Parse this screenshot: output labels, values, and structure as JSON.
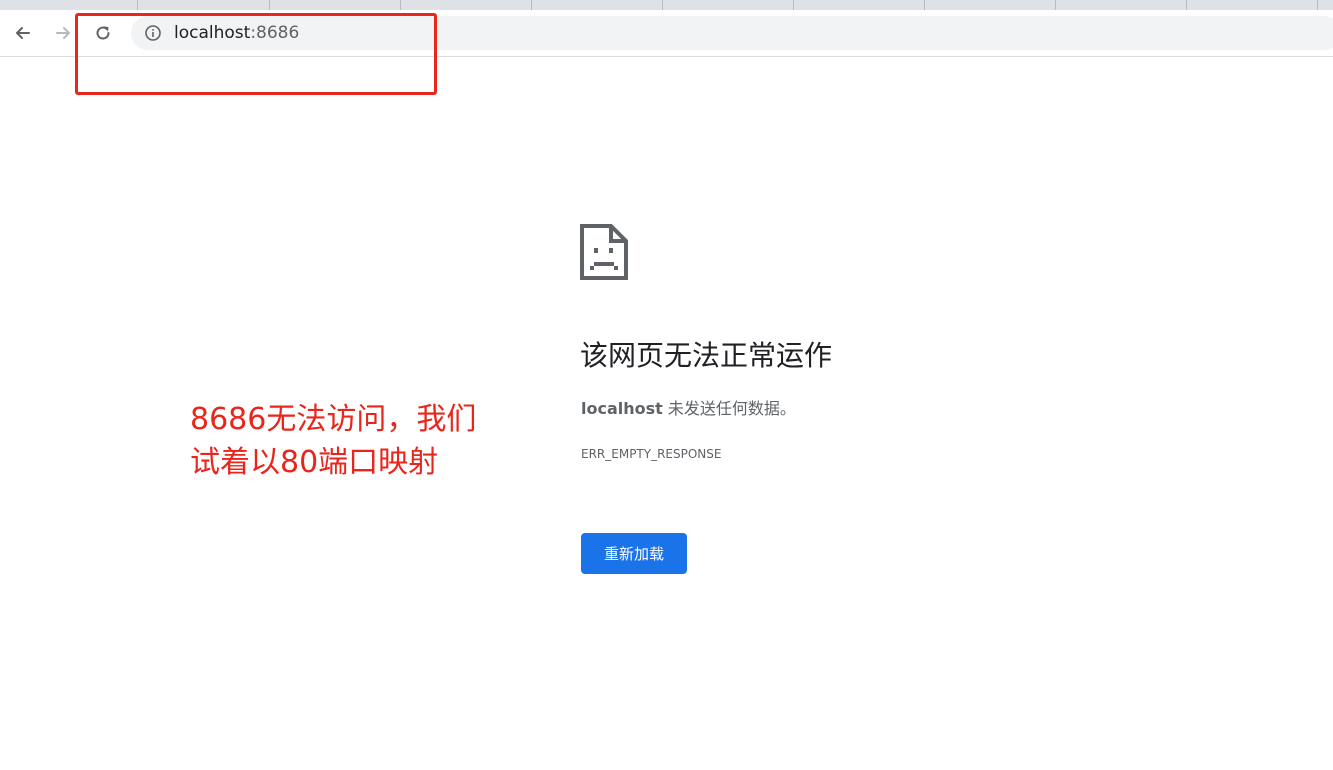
{
  "browser": {
    "back_icon": "arrow-left-icon",
    "forward_icon": "arrow-right-icon",
    "reload_icon": "reload-icon",
    "site_info_icon": "info-icon",
    "url_host": "localhost",
    "url_port": ":8686"
  },
  "error_page": {
    "icon": "sad-document-icon",
    "title": "该网页无法正常运作",
    "description_host": "localhost",
    "description_text": " 未发送任何数据。",
    "error_code": "ERR_EMPTY_RESPONSE",
    "reload_label": "重新加载"
  },
  "annotation": {
    "note_line1": "8686无法访问，我们",
    "note_line2": "试着以80端口映射",
    "color": "#e8261c"
  },
  "colors": {
    "primary_button": "#1a73e8",
    "text_primary": "#202124",
    "text_secondary": "#5f6368"
  }
}
